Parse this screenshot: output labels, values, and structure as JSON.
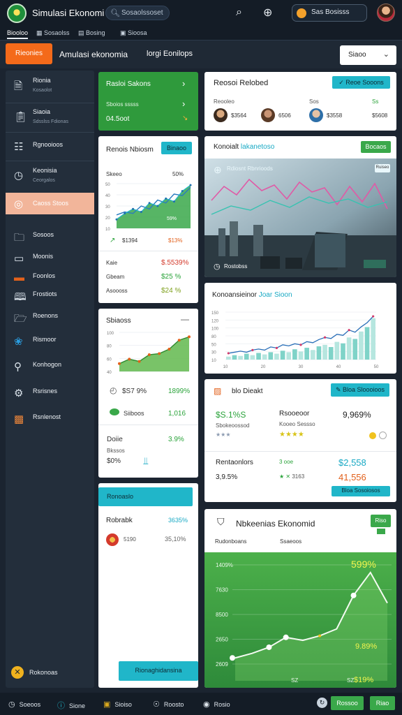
{
  "topbar": {
    "app_title": "Simulasi Ekonomi",
    "search_placeholder": "Sosaolssoset",
    "user_name": "Sas Bosisss"
  },
  "tabs": [
    "Biooloo",
    "Sosaolss",
    "Bosing",
    "Sioosa"
  ],
  "header": {
    "button_label": "Rieonies",
    "title": "Amulasi ekonomia",
    "subtitle": "lorgi  Eonilops",
    "dropdown_value": "Siaoo"
  },
  "sidebar": {
    "items": [
      {
        "label": "Rionia",
        "sub": "Kosaolot",
        "icon": "document-icon"
      },
      {
        "label": "Siaoia",
        "sub": "Sdsslss Fdionas",
        "icon": "clipboard-icon"
      },
      {
        "label": "Rgnooioos",
        "sub": "",
        "icon": "report-icon"
      },
      {
        "label": "Keonisia",
        "sub": "Ceorgalos",
        "icon": "clock-icon"
      },
      {
        "label": "Caoss Stoos",
        "sub": "",
        "icon": "target-icon"
      },
      {
        "label": "Sosoos",
        "sub": "",
        "icon": "folder-icon"
      },
      {
        "label": "Moonis",
        "sub": "",
        "icon": "monitor-icon"
      },
      {
        "label": "Foonlos",
        "sub": "",
        "icon": "card-icon"
      },
      {
        "label": "Frostiots",
        "sub": "",
        "icon": "book-icon"
      },
      {
        "label": "Roenons",
        "sub": "",
        "icon": "folder-icon"
      },
      {
        "label": "Rismoor",
        "sub": "",
        "icon": "pinwheel-icon"
      },
      {
        "label": "Konhogon",
        "sub": "",
        "icon": "search-icon"
      },
      {
        "label": "Rsrisnes",
        "sub": "",
        "icon": "gear-icon"
      },
      {
        "label": "Rsnlenost",
        "sub": "",
        "icon": "gift-icon"
      }
    ],
    "footer_label": "Rokonoas"
  },
  "green_card": {
    "title": "Rasloi Sakons",
    "row2": "Sboios sssss",
    "amount": "04.5oot"
  },
  "rebounds_card": {
    "title": "Reosoi Relobed",
    "badge": "Reoe Sooons",
    "col1_header": "Reooleo",
    "col2_header": "Sos",
    "col3_header": "Ss",
    "p1": "$3564",
    "p2": "6506",
    "p3": "$3558",
    "p4": "$5608"
  },
  "chart1_card": {
    "title": "Renois Nbiosm",
    "badge": "Binaoo",
    "header_left": "Skeeo",
    "header_right": "50%",
    "bar_label": "59%",
    "stat_left": "$1394",
    "stat_right": "$13%",
    "rows": [
      {
        "label": "Kaie",
        "value": "$.5539%"
      },
      {
        "label": "Gbeam",
        "value": "$25 %"
      },
      {
        "label": "Asoooss",
        "value": "$24 %"
      }
    ]
  },
  "banner_card": {
    "title_a": "Konoialt",
    "title_b": "lakanetoso",
    "badge": "Bocaos",
    "overlay_title": "Rdiosnt Rbnrioods",
    "overlay_btn": "Ruiseo",
    "caption": "Rostobss"
  },
  "chart2_card": {
    "title_a": "Konoansieinor",
    "title_b": "Joar Sioon"
  },
  "chart3_card": {
    "title": "Sbiaoss",
    "stat1_left": "$S7 9%",
    "stat1_right": "1899%",
    "stat2_left": "Siiboos",
    "stat2_right": "1,016",
    "footer_label": "Doiie",
    "footer_right": "3.9%",
    "footer_sub": "Bkssos",
    "footer_val": "$0%"
  },
  "bid_card": {
    "title": "blo Dieakt",
    "badge": "Bloa Sloooioos",
    "cells": {
      "v1": "$S.1%S",
      "v1_sub": "Sbokeoossod",
      "v2": "Rsooeoor",
      "v2_sub": "Kooeo Sessso",
      "v3": "9,969%",
      "r1_label": "Rentaonlors",
      "r1_mid": "3 ooe",
      "r1_val": "$2,558",
      "r2_left": "3,9.5%",
      "r2_mid": "3163",
      "r2_val": "41,556"
    },
    "action": "Bloa Sosoiosos"
  },
  "teal_card": {
    "header": "Ronoaslo",
    "row1_label": "Robrabk",
    "row1_value": "3635%",
    "row2_label": "5190",
    "row2_value": "35,10%",
    "button": "Rionaghidansina"
  },
  "big_card": {
    "title": "Nbkeenias Ekonomid",
    "subtitle": "Rudonboans",
    "subtitle2": "Ssaeoos",
    "badge": "Riso",
    "chart_value": "599%",
    "end_value": "9.89%",
    "bottom_value": "$19%"
  },
  "bottombar": {
    "items": [
      {
        "label": "Soeoos",
        "icon": "clock-icon"
      },
      {
        "label": "Sione",
        "icon": "info-icon"
      },
      {
        "label": "Sioiso",
        "icon": "doc-icon"
      },
      {
        "label": "Roosto",
        "icon": "compass-icon"
      },
      {
        "label": "Rosio",
        "icon": "globe-icon"
      }
    ],
    "btn1": "Rossoo",
    "btn2": "Riao"
  },
  "chart_data": [
    {
      "type": "area",
      "y_ticks": [
        "50",
        "40",
        "30",
        "20",
        "10"
      ],
      "series": [
        {
          "values": [
            18,
            22,
            20,
            30,
            26,
            38,
            34,
            46,
            44,
            55
          ]
        },
        {
          "values": [
            12,
            20,
            26,
            22,
            34,
            30,
            40,
            36,
            50,
            58
          ]
        }
      ]
    },
    {
      "type": "bar",
      "y_ticks": [
        "150",
        "120",
        "100",
        "80",
        "50",
        "30",
        "10"
      ],
      "x_ticks": [
        "10",
        "20",
        "30",
        "40",
        "50"
      ],
      "values": [
        4,
        6,
        5,
        8,
        6,
        9,
        7,
        10,
        8,
        12,
        10,
        14,
        11,
        16,
        13,
        18,
        20,
        17,
        24,
        22,
        30,
        28,
        38,
        44,
        56
      ],
      "line": [
        12,
        14,
        16,
        14,
        18,
        20,
        18,
        24,
        22,
        28,
        26,
        30,
        28,
        34,
        32,
        38,
        42,
        40,
        48,
        46,
        56,
        52,
        62,
        70,
        82
      ]
    },
    {
      "type": "area",
      "y_ticks": [
        "100",
        "80",
        "60",
        "40"
      ],
      "values": [
        14,
        22,
        18,
        30,
        32,
        40,
        56,
        62
      ]
    },
    {
      "type": "line",
      "y_ticks": [
        "1409%",
        "7630",
        "8500",
        "2650",
        "2609"
      ],
      "x_ticks": [
        "",
        "SZ",
        "SZ",
        ""
      ],
      "values": [
        16,
        28,
        44,
        70,
        62,
        74,
        92,
        180,
        240,
        160
      ]
    }
  ]
}
